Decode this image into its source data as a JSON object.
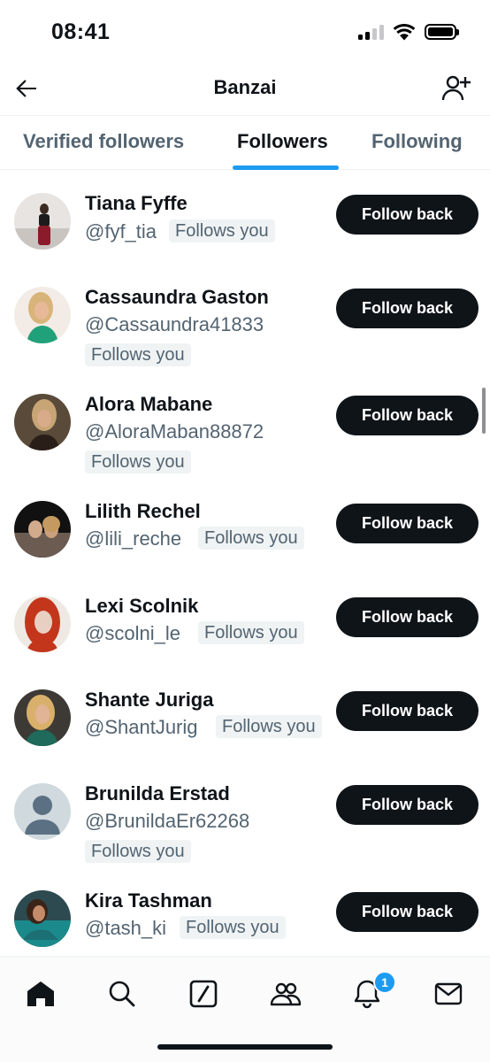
{
  "status_bar": {
    "time": "08:41"
  },
  "header": {
    "title": "Banzai"
  },
  "tabs": [
    {
      "label": "Verified followers"
    },
    {
      "label": "Followers",
      "active": true
    },
    {
      "label": "Following"
    }
  ],
  "followers": [
    {
      "name": "Tiana Fyffe",
      "handle": "@fyf_tia",
      "badge": "Follows you",
      "button": "Follow back"
    },
    {
      "name": "Cassaundra Gaston",
      "handle": "@Cassaundra41833",
      "badge": "Follows you",
      "button": "Follow back"
    },
    {
      "name": "Alora Mabane",
      "handle": "@AloraMaban88872",
      "badge": "Follows you",
      "button": "Follow back"
    },
    {
      "name": "Lilith Rechel",
      "handle": "@lili_reche",
      "badge": "Follows you",
      "button": "Follow back"
    },
    {
      "name": "Lexi Scolnik",
      "handle": "@scolni_le",
      "badge": "Follows you",
      "button": "Follow back"
    },
    {
      "name": "Shante Juriga",
      "handle": "@ShantJurig",
      "badge": "Follows you",
      "button": "Follow back"
    },
    {
      "name": "Brunilda Erstad",
      "handle": "@BrunildaEr62268",
      "badge": "Follows you",
      "button": "Follow back"
    },
    {
      "name": "Kira Tashman",
      "handle": "@tash_ki",
      "badge": "Follows you",
      "button": "Follow back"
    }
  ],
  "bottom_nav": {
    "items": [
      "home-icon",
      "search-icon",
      "grok-icon",
      "communities-icon",
      "notifications-icon",
      "messages-icon"
    ],
    "notification_count": "1"
  },
  "colors": {
    "accent": "#1d9bf0",
    "button": "#0f1419",
    "secondary_text": "#536471",
    "badge_bg": "#eff3f4"
  }
}
